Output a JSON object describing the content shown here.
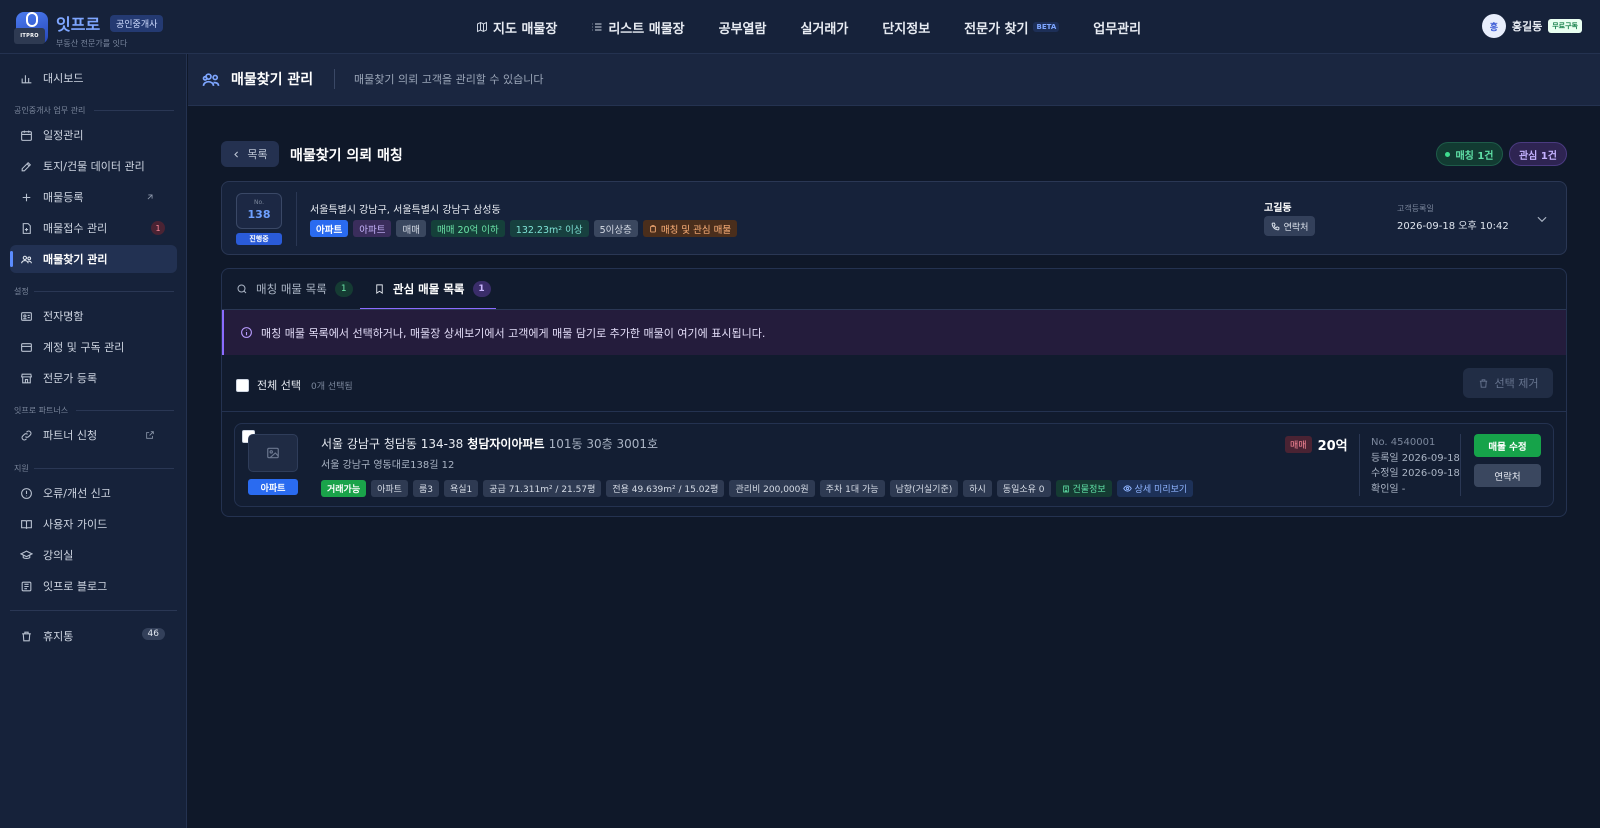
{
  "app": {
    "logo_text": "ITPRO",
    "name": "잇프로",
    "badge": "공인중개사",
    "tagline": "부동산 전문가를 잇다"
  },
  "nav": {
    "items": [
      {
        "label": "지도 매물장",
        "icon": "map-icon"
      },
      {
        "label": "리스트 매물장",
        "icon": "list-icon"
      },
      {
        "label": "공부열람"
      },
      {
        "label": "실거래가"
      },
      {
        "label": "단지정보"
      },
      {
        "label": "전문가 찾기",
        "beta": "BETA"
      },
      {
        "label": "업무관리"
      }
    ]
  },
  "user": {
    "avatar": "홍",
    "name": "홍길동",
    "plan": "무료구독"
  },
  "sidebar": {
    "dashboard": "대시보드",
    "section_work": "공인중개사 업무 관리",
    "items_work": [
      "일정관리",
      "토지/건물 데이터 관리",
      "매물등록",
      "매물접수 관리",
      "매물찾기 관리"
    ],
    "inbox_badge": "1",
    "section_settings": "설정",
    "items_settings": [
      "전자명함",
      "계정 및 구독 관리",
      "전문가 등록"
    ],
    "section_partners": "잇프로 파트너스",
    "partner": "파트너 신청",
    "section_support": "지원",
    "items_support": [
      "오류/개선 신고",
      "사용자 가이드",
      "강의실",
      "잇프로 블로그"
    ],
    "trash": "휴지통",
    "trash_count": "46"
  },
  "header": {
    "title": "매물찾기 관리",
    "desc": "매물찾기 의뢰 고객을 관리할 수 있습니다"
  },
  "content": {
    "back": "목록",
    "title": "매물찾기 의뢰 매칭",
    "match_pill": "매칭 1건",
    "interest_pill": "관심 1건"
  },
  "request": {
    "no_label": "No.",
    "no": "138",
    "status": "진행중",
    "location": "서울특별시 강남구, 서울특별시 강남구 삼성동",
    "tags": [
      "아파트",
      "아파트",
      "매매",
      "매매 20억 이하",
      "132.23m² 이상",
      "5이상층",
      "매칭 및 관심 매물"
    ],
    "customer": "고길동",
    "contact": "연락처",
    "reg_label": "고객등록일",
    "reg_date": "2026-09-18 오후 10:42"
  },
  "tabs": [
    {
      "label": "매칭 매물 목록",
      "count": "1"
    },
    {
      "label": "관심 매물 목록",
      "count": "1"
    }
  ],
  "info_text": "매칭 매물 목록에서 선택하거나, 매물장 상세보기에서 고객에게 매물 담기로 추가한 매물이 여기에 표시됩니다.",
  "selection": {
    "all": "전체 선택",
    "count": "0개 선택됨",
    "remove": "선택 제거"
  },
  "listing": {
    "type": "아파트",
    "address": "서울 강남구 청담동 134-38",
    "building": "청담자이아파트",
    "unit": "101동 30층 3001호",
    "road": "서울 강남구 영동대로138길 12",
    "tags": [
      "거래가능",
      "아파트",
      "룸3",
      "욕실1",
      "공급 71.311m² / 21.57평",
      "전용 49.639m² / 15.02평",
      "관리비 200,000원",
      "주차 1대 가능",
      "남향(거실기준)",
      "하시",
      "동일소유 0",
      "건물정보",
      "상세 미리보기"
    ],
    "deal_type": "매매",
    "price": "20억",
    "no": "No. 4540001",
    "registered": "등록일 2026-09-18",
    "modified": "수정일 2026-09-18",
    "confirmed": "확인일 -",
    "edit": "매물 수정",
    "contact": "연락처"
  },
  "colors": {
    "accent": "#2a6bf0",
    "success": "#16a34a",
    "interest": "#8b6bff"
  }
}
